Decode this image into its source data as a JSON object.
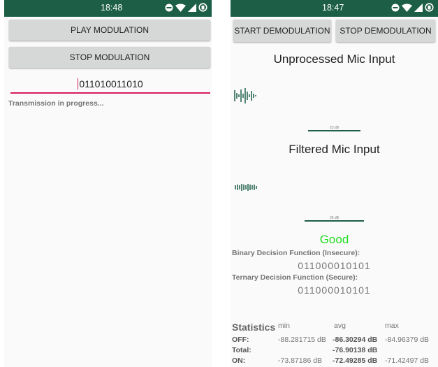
{
  "left": {
    "status_time": "18:48",
    "play_label": "PLAY MODULATION",
    "stop_label": "STOP MODULATION",
    "input_value": "011010011010",
    "message": "Transmission in progress..."
  },
  "right": {
    "status_time": "18:47",
    "start_label": "START DEMODULATION",
    "stop_label": "STOP DEMODULATION",
    "unprocessed_title": "Unprocessed Mic Input",
    "unprocessed_level": "23 dB",
    "filtered_title": "Filtered Mic Input",
    "filtered_level": "26 dB",
    "quality": "Good",
    "binary_label": "Binary Decision Function (Insecure):",
    "binary_value": "011000010101",
    "ternary_label": "Ternary Decision Function (Secure):",
    "ternary_value": "011000010101",
    "stats": {
      "title": "Statistics",
      "headers": [
        "min",
        "avg",
        "max"
      ],
      "rows": [
        {
          "label": "OFF:",
          "min": "-88.281715 dB",
          "avg": "-86.30294 dB",
          "max": "-84.96379 dB"
        },
        {
          "label": "Total:",
          "min": "",
          "avg": "-76.90138 dB",
          "max": ""
        },
        {
          "label": "ON:",
          "min": "-73.87186 dB",
          "avg": "-72.49285 dB",
          "max": "-71.42497 dB"
        }
      ]
    }
  },
  "colors": {
    "statusbar": "#1c5e46",
    "accent_line": "#d81b60",
    "waveform": "#1c5e46",
    "good": "#22dd22"
  },
  "icons": [
    "do-not-disturb-icon",
    "wifi-icon",
    "signal-icon",
    "battery-saver-icon"
  ]
}
